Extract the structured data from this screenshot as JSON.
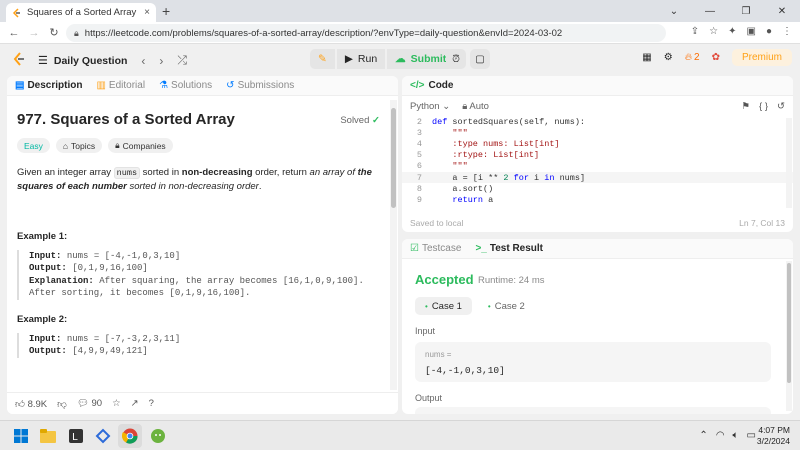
{
  "browser": {
    "tab_title": "Squares of a Sorted Array - LeetC",
    "tab_close": "×",
    "new_tab": "+",
    "url": "https://leetcode.com/problems/squares-of-a-sorted-array/description/?envType=daily-question&envId=2024-03-02"
  },
  "nav": {
    "daily_label": "Daily Question",
    "run_label": "Run",
    "submit_label": "Submit",
    "streak_count": "2",
    "premium_label": "Premium"
  },
  "left_tabs": {
    "description": "Description",
    "editorial": "Editorial",
    "solutions": "Solutions",
    "submissions": "Submissions"
  },
  "problem": {
    "title": "977. Squares of a Sorted Array",
    "solved_label": "Solved",
    "difficulty": "Easy",
    "topics_label": "Topics",
    "companies_label": "Companies",
    "desc_part1": "Given an integer array ",
    "desc_code": "nums",
    "desc_part2": " sorted in ",
    "desc_bold": "non-decreasing",
    "desc_part3": " order, return ",
    "desc_italic1": "an array of ",
    "desc_bolditalic": "the squares of each number",
    "desc_italic2": " sorted in non-decreasing order",
    "desc_end": "."
  },
  "examples": [
    {
      "title": "Example 1:",
      "input_label": "Input:",
      "input": "nums = [-4,-1,0,3,10]",
      "output_label": "Output:",
      "output": "[0,1,9,16,100]",
      "explanation_label": "Explanation:",
      "explanation1": "After squaring, the array becomes [16,1,0,9,100].",
      "explanation2": "After sorting, it becomes [0,1,9,16,100]."
    },
    {
      "title": "Example 2:",
      "input_label": "Input:",
      "input": "nums = [-7,-3,2,3,11]",
      "output_label": "Output:",
      "output": "[4,9,9,49,121]"
    }
  ],
  "left_footer": {
    "likes": "8.9K",
    "comments": "90"
  },
  "code_panel": {
    "title": "Code",
    "language": "Python",
    "auto_label": "Auto",
    "saved_text": "Saved to local",
    "cursor_pos": "Ln 7, Col 13",
    "lines": [
      {
        "n": "2",
        "text": "def sortedSquares(self, nums):"
      },
      {
        "n": "3",
        "text": "    \"\"\""
      },
      {
        "n": "4",
        "text": "    :type nums: List[int]"
      },
      {
        "n": "5",
        "text": "    :rtype: List[int]"
      },
      {
        "n": "6",
        "text": "    \"\"\""
      },
      {
        "n": "7",
        "text": "    a = [i ** 2 for i in nums]"
      },
      {
        "n": "8",
        "text": "    a.sort()"
      },
      {
        "n": "9",
        "text": "    return a"
      }
    ]
  },
  "result_panel": {
    "testcase_tab": "Testcase",
    "result_tab": "Test Result",
    "status": "Accepted",
    "runtime": "Runtime: 24 ms",
    "case1": "Case 1",
    "case2": "Case 2",
    "input_label": "Input",
    "param_name": "nums =",
    "param_value": "[-4,-1,0,3,10]",
    "output_label": "Output"
  },
  "taskbar": {
    "time": "4:07 PM",
    "date": "3/2/2024"
  },
  "colors": {
    "accent_green": "#2cbb5d",
    "accent_orange": "#ffa116",
    "easy": "#00b8a3"
  }
}
